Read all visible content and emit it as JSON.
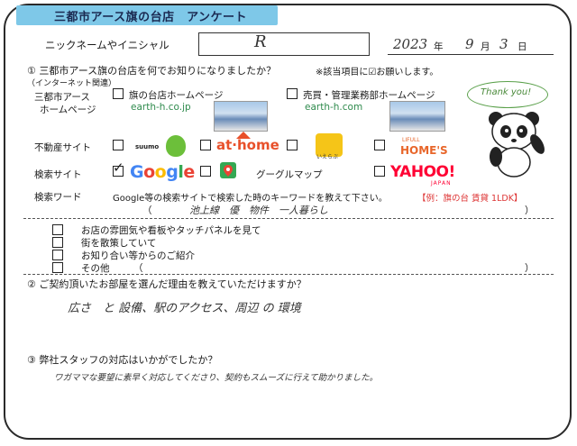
{
  "header": {
    "title": "三都市アース旗の台店　アンケート"
  },
  "nickname": {
    "label": "ニックネームやイニシャル",
    "value": "R",
    "year": "2023",
    "year_unit": "年",
    "month": "9",
    "month_unit": "月",
    "day": "3",
    "day_unit": "日"
  },
  "q1": {
    "question": "① 三都市アース旗の台店を何でお知りになりましたか？",
    "note": "※該当項目に☑お願いします。",
    "sub": "（インターネット関連）",
    "santo_label_1": "三都市アース",
    "santo_label_2": "ホームページ",
    "opt_hatanodai": "旗の台店ホームページ",
    "url_hatanodai": "earth-h.co.jp",
    "opt_baibai": "売買・管理業務部ホームページ",
    "url_baibai": "earth-h.com",
    "fudosan_label": "不動産サイト",
    "logo_suumo": "suumo",
    "logo_athome": "at·home",
    "logo_ieul": "いえらぶ",
    "logo_homes_sub": "LIFULL",
    "logo_homes": "HOME'S",
    "kensaku_label": "検索サイト",
    "check_mark": "✓",
    "logo_google": [
      "G",
      "o",
      "o",
      "g",
      "l",
      "e"
    ],
    "maps_label": "グーグルマップ",
    "logo_yahoo": "YAHOO!",
    "logo_yahoo_sub": "JAPAN",
    "keyword_label": "検索ワード",
    "keyword_prompt": "Google等の検索サイトで検索した時のキーワードを教えて下さい。",
    "keyword_example": "【例：旗の台 賃貸 1LDK】",
    "keyword_open": "（",
    "keyword_value": "池上線　優　物件　一人暮らし",
    "keyword_close": "）",
    "other_1": "お店の雰囲気や看板やタッチパネルを見て",
    "other_2": "街を散策していて",
    "other_3": "お知り合い等からのご紹介",
    "other_4": "その他",
    "other_open": "（",
    "other_close": "）"
  },
  "q2": {
    "question": "② ご契約頂いたお部屋を選んだ理由を教えていただけますか？",
    "answer": "広さ　と 設備、駅のアクセス、周辺 の 環境"
  },
  "q3": {
    "question": "③ 弊社スタッフの対応はいかがでしたか？",
    "answer": "ワガママな要望に素早く対応してくださり、契約もスムーズに行えて助かりました。"
  },
  "mascot": {
    "bubble_text": "Thank you!"
  }
}
